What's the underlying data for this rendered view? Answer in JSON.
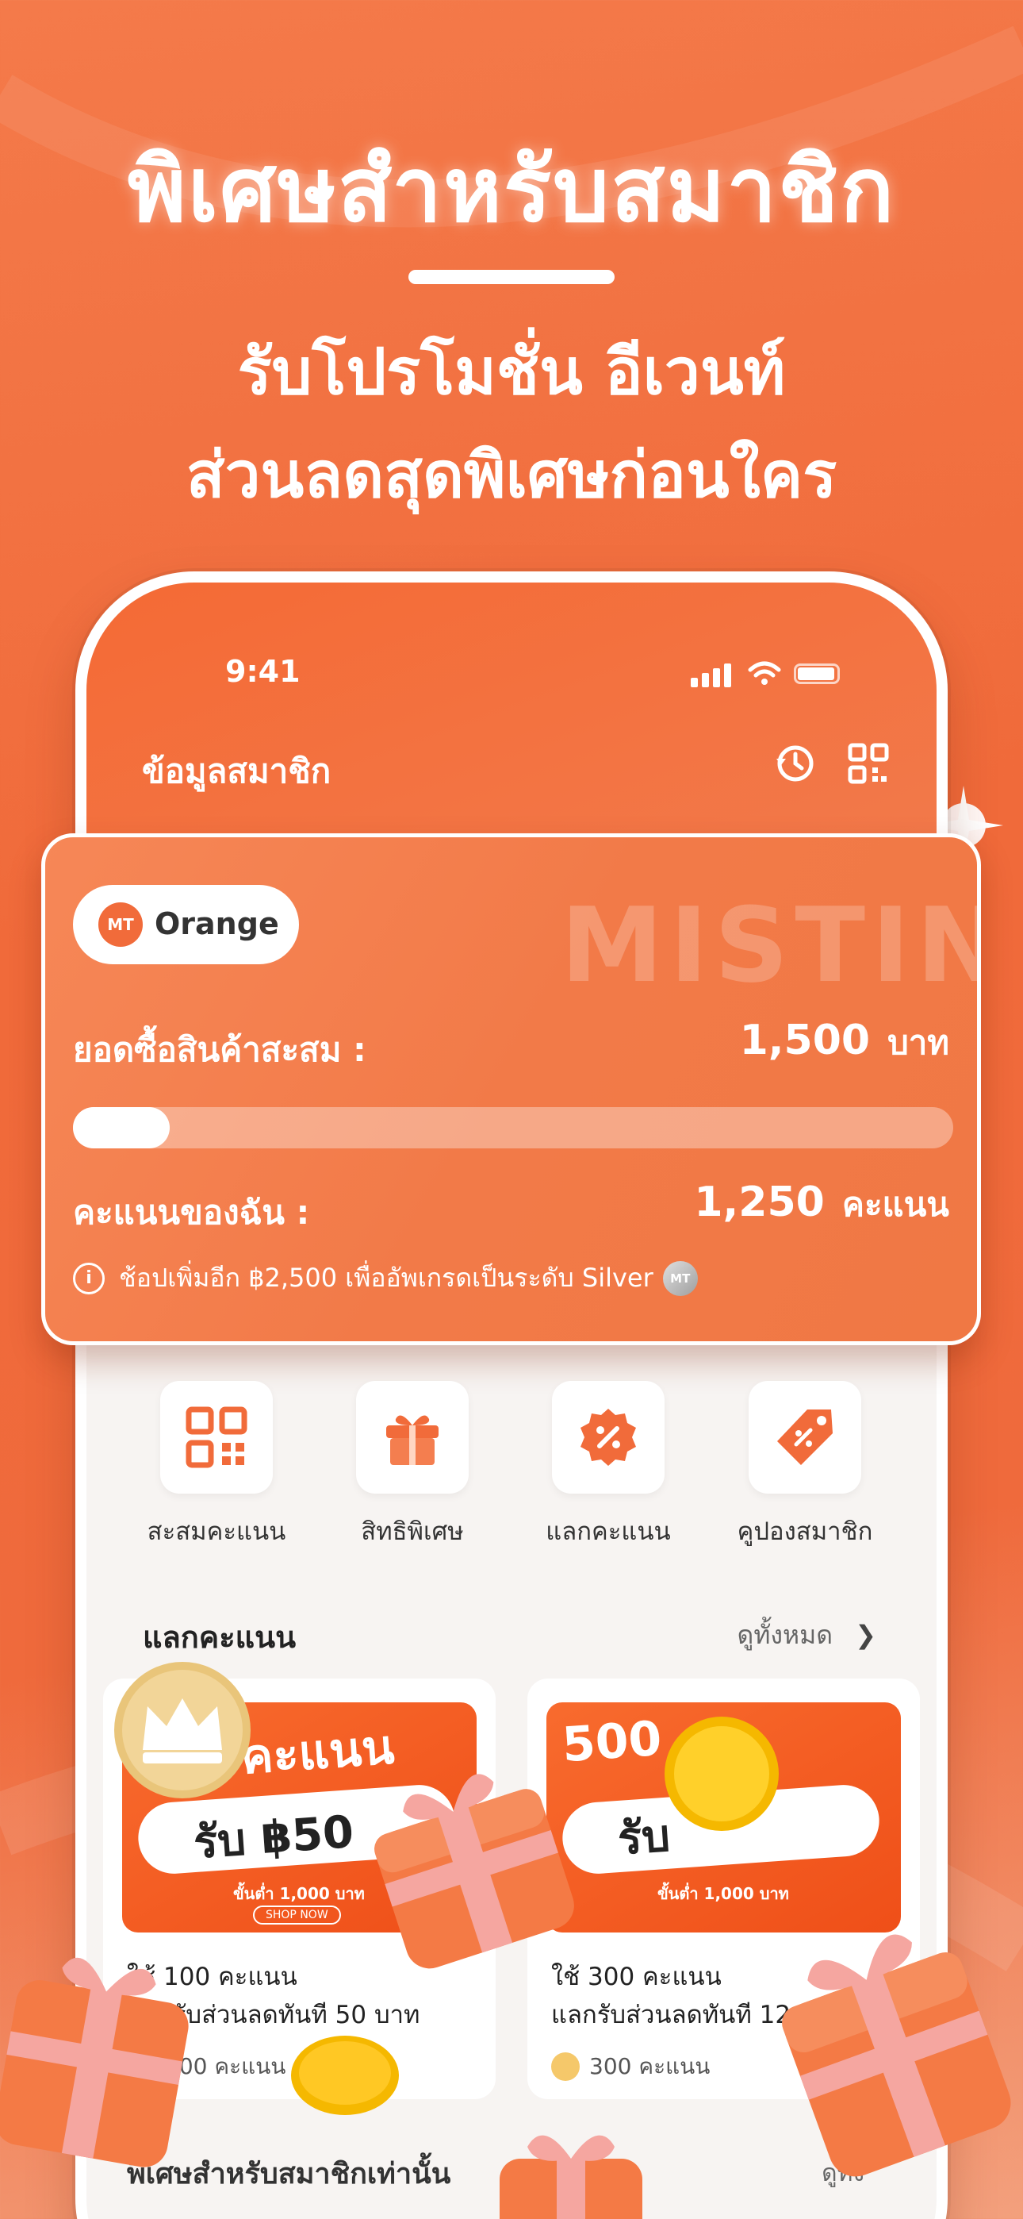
{
  "headline": "พิเศษสำหรับสมาชิก",
  "subheadline_line1": "รับโปรโมชั่น อีเวนท์",
  "subheadline_line2": "ส่วนลดสุดพิเศษก่อนใคร",
  "status_bar": {
    "time": "9:41"
  },
  "screen": {
    "title": "ข้อมูลสมาชิก",
    "icons": [
      "history-icon",
      "qr-code-icon"
    ]
  },
  "member_card": {
    "brand_watermark": "MISTIN",
    "tier_logo": "MT",
    "tier_name": "Orange",
    "purchase_label": "ยอดซื้อสินค้าสะสม :",
    "purchase_value": "1,500",
    "purchase_unit": "บาท",
    "progress": 0.11,
    "points_label": "คะแนนของฉัน :",
    "points_value": "1,250",
    "points_unit": "คะแนน",
    "upgrade_note": "ช้อปเพิ่มอีก ฿2,500 เพื่ออัพเกรดเป็นระดับ Silver",
    "silver_logo": "MT"
  },
  "quick_menu": [
    {
      "label": "สะสมคะแนน",
      "icon": "qr-code-icon"
    },
    {
      "label": "สิทธิพิเศษ",
      "icon": "gift-icon"
    },
    {
      "label": "แลกคะแนน",
      "icon": "percent-badge-icon"
    },
    {
      "label": "คูปองสมาชิก",
      "icon": "coupon-tag-icon"
    }
  ],
  "redeem_section": {
    "title": "แลกคะแนน",
    "see_all": "ดูทั้งหมด"
  },
  "rewards": [
    {
      "banner_points": "คะแนน",
      "banner_get": "รับ ฿50",
      "banner_min": "ขั้นต่ำ 1,000 บาท",
      "banner_button": "SHOP NOW",
      "title": "ใช้ 100 คะแนน",
      "desc": "แลกรับส่วนลดทันที 50 บาท",
      "cost": "100 คะแนน"
    },
    {
      "banner_points": "500",
      "banner_get": "รับ",
      "banner_min": "ขั้นต่ำ 1,000 บาท",
      "banner_button": "",
      "title": "ใช้ 300 คะแนน",
      "desc": "แลกรับส่วนลดทันที 12",
      "cost": "300 คะแนน"
    }
  ],
  "exclusive_section": {
    "title": "พิเศษสำหรับสมาชิกเท่านั้น",
    "see_all": "ดูทั้ง"
  }
}
